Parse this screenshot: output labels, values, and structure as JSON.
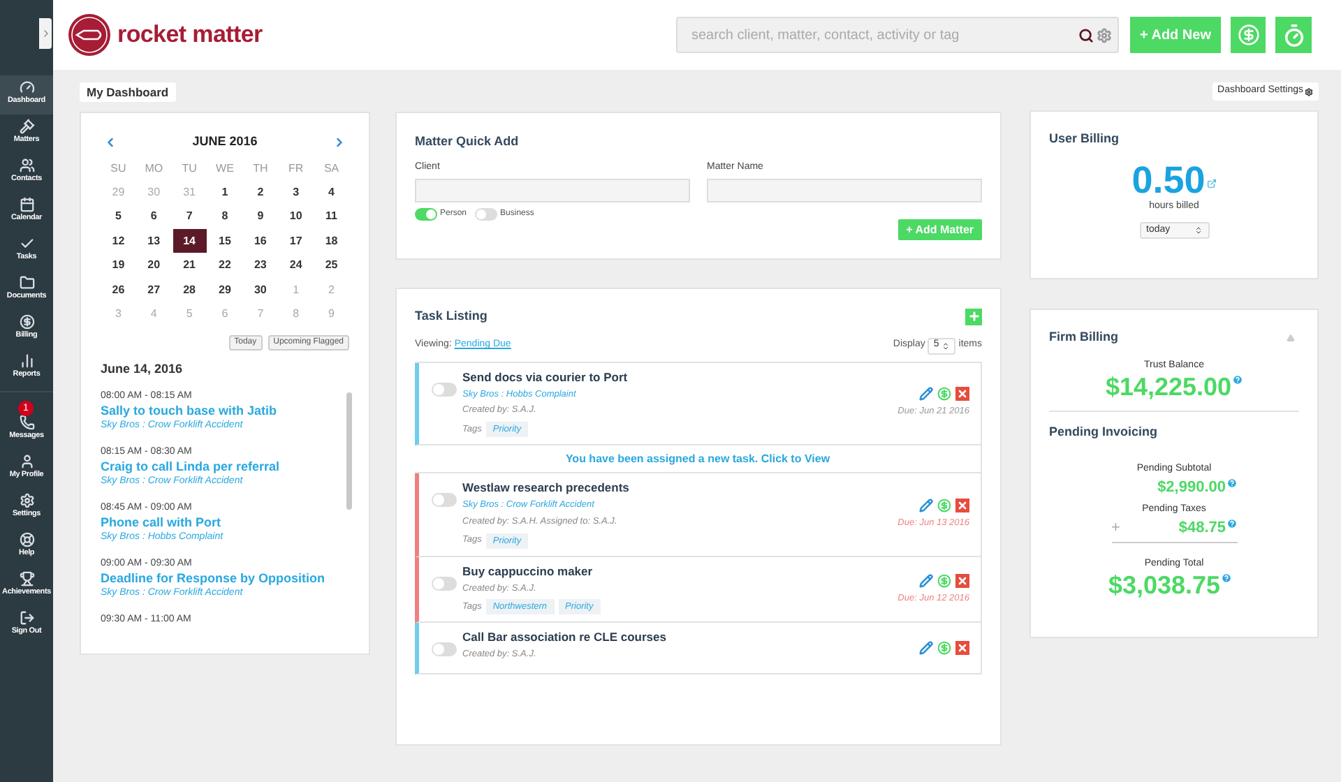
{
  "sidebar": {
    "items": [
      {
        "label": "Dashboard",
        "selected": true
      },
      {
        "label": "Matters",
        "selected": false
      },
      {
        "label": "Contacts",
        "selected": false
      },
      {
        "label": "Calendar",
        "selected": false
      },
      {
        "label": "Tasks",
        "selected": false
      },
      {
        "label": "Documents",
        "selected": false
      },
      {
        "label": "Billing",
        "selected": false
      },
      {
        "label": "Reports",
        "selected": false
      },
      {
        "label": "Messages",
        "selected": false,
        "badge": "1"
      },
      {
        "label": "My Profile",
        "selected": false
      },
      {
        "label": "Settings",
        "selected": false
      },
      {
        "label": "Help",
        "selected": false
      },
      {
        "label": "Achievements",
        "selected": false
      },
      {
        "label": "Sign Out",
        "selected": false
      }
    ]
  },
  "header": {
    "logo": "rocket matter",
    "search": {
      "placeholder": "search client, matter, contact, activity or tag"
    },
    "add_new": "+ Add New"
  },
  "dashboard_tab": "My Dashboard",
  "dashboard_settings": "Dashboard Settings",
  "calendar": {
    "month": "JUNE 2016",
    "weekdays": [
      "SU",
      "MO",
      "TU",
      "WE",
      "TH",
      "FR",
      "SA"
    ],
    "days": [
      {
        "d": "29",
        "outside": true,
        "selected": false
      },
      {
        "d": "30",
        "outside": true,
        "selected": false
      },
      {
        "d": "31",
        "outside": true,
        "selected": false
      },
      {
        "d": "1",
        "outside": false,
        "selected": false
      },
      {
        "d": "2",
        "outside": false,
        "selected": false
      },
      {
        "d": "3",
        "outside": false,
        "selected": false
      },
      {
        "d": "4",
        "outside": false,
        "selected": false
      },
      {
        "d": "5",
        "outside": false,
        "selected": false
      },
      {
        "d": "6",
        "outside": false,
        "selected": false
      },
      {
        "d": "7",
        "outside": false,
        "selected": false
      },
      {
        "d": "8",
        "outside": false,
        "selected": false
      },
      {
        "d": "9",
        "outside": false,
        "selected": false
      },
      {
        "d": "10",
        "outside": false,
        "selected": false
      },
      {
        "d": "11",
        "outside": false,
        "selected": false
      },
      {
        "d": "12",
        "outside": false,
        "selected": false
      },
      {
        "d": "13",
        "outside": false,
        "selected": false
      },
      {
        "d": "14",
        "outside": false,
        "selected": true
      },
      {
        "d": "15",
        "outside": false,
        "selected": false
      },
      {
        "d": "16",
        "outside": false,
        "selected": false
      },
      {
        "d": "17",
        "outside": false,
        "selected": false
      },
      {
        "d": "18",
        "outside": false,
        "selected": false
      },
      {
        "d": "19",
        "outside": false,
        "selected": false
      },
      {
        "d": "20",
        "outside": false,
        "selected": false
      },
      {
        "d": "21",
        "outside": false,
        "selected": false
      },
      {
        "d": "22",
        "outside": false,
        "selected": false
      },
      {
        "d": "23",
        "outside": false,
        "selected": false
      },
      {
        "d": "24",
        "outside": false,
        "selected": false
      },
      {
        "d": "25",
        "outside": false,
        "selected": false
      },
      {
        "d": "26",
        "outside": false,
        "selected": false
      },
      {
        "d": "27",
        "outside": false,
        "selected": false
      },
      {
        "d": "28",
        "outside": false,
        "selected": false
      },
      {
        "d": "29",
        "outside": false,
        "selected": false
      },
      {
        "d": "30",
        "outside": false,
        "selected": false
      },
      {
        "d": "1",
        "outside": true,
        "selected": false
      },
      {
        "d": "2",
        "outside": true,
        "selected": false
      },
      {
        "d": "3",
        "outside": true,
        "selected": false
      },
      {
        "d": "4",
        "outside": true,
        "selected": false
      },
      {
        "d": "5",
        "outside": true,
        "selected": false
      },
      {
        "d": "6",
        "outside": true,
        "selected": false
      },
      {
        "d": "7",
        "outside": true,
        "selected": false
      },
      {
        "d": "8",
        "outside": true,
        "selected": false
      },
      {
        "d": "9",
        "outside": true,
        "selected": false
      }
    ],
    "buttons": [
      "Today",
      "Upcoming Flagged"
    ],
    "date": "June 14, 2016",
    "events": [
      {
        "time": "08:00 AM - 08:15 AM",
        "title": "Sally to touch base with Jatib",
        "matter": "Sky Bros : Crow Forklift Accident"
      },
      {
        "time": "08:15 AM - 08:30 AM",
        "title": "Craig to call Linda per referral",
        "matter": "Sky Bros : Crow Forklift Accident"
      },
      {
        "time": "08:45 AM - 09:00 AM",
        "title": "Phone call with Port",
        "matter": "Sky Bros : Hobbs Complaint"
      },
      {
        "time": "09:00 AM - 09:30 AM",
        "title": "Deadline for Response by Opposition",
        "matter": "Sky Bros : Crow Forklift Accident"
      },
      {
        "time": "09:30 AM - 11:00 AM"
      }
    ]
  },
  "matter_quick_add": {
    "title": "Matter Quick Add",
    "client_label": "Client",
    "matter_label": "Matter Name",
    "toggles": [
      {
        "label": "Person",
        "on": true
      },
      {
        "label": "Business",
        "on": false
      }
    ],
    "button": "+ Add Matter"
  },
  "task_listing": {
    "title": "Task Listing",
    "viewing": "Viewing:",
    "filter": "Pending Due",
    "display": "Display",
    "count": "5",
    "items_label": "items",
    "rows": [
      {
        "kind": "task",
        "title": "Send docs via courier to Port",
        "matter": "Sky Bros : Hobbs Complaint",
        "created": "Created by: S.A.J.",
        "tags_label": "Tags",
        "tags": [
          "Priority"
        ],
        "due": "Due: Jun 21 2016",
        "overdue": false,
        "color": "#6fcdf0",
        "done": false
      },
      {
        "kind": "notice",
        "text": "You have been assigned a new task. Click to View"
      },
      {
        "kind": "task",
        "title": "Westlaw research precedents",
        "matter": "Sky Bros : Crow Forklift Accident",
        "created": "Created by: S.A.H. Assigned to: S.A.J.",
        "tags_label": "Tags",
        "tags": [
          "Priority"
        ],
        "due": "Due: Jun 13 2016",
        "overdue": true,
        "color": "#f08080",
        "done": false
      },
      {
        "kind": "task",
        "title": "Buy cappuccino maker",
        "created": "Created by: S.A.J.",
        "tags_label": "Tags",
        "tags": [
          "Northwestern",
          "Priority"
        ],
        "due": "Due: Jun 12 2016",
        "overdue": true,
        "color": "#f08080",
        "done": false
      },
      {
        "kind": "task",
        "title": "Call Bar association re CLE courses",
        "created": "Created by: S.A.J.",
        "color": "#6fcdf0",
        "done": false
      }
    ]
  },
  "user_billing": {
    "title": "User Billing",
    "hours": "0.50",
    "hours_label": "hours billed",
    "period": "today"
  },
  "firm_billing": {
    "title": "Firm Billing",
    "trust_label": "Trust Balance",
    "trust": "$14,225.00",
    "pending_title": "Pending Invoicing",
    "subtotal_label": "Pending Subtotal",
    "subtotal": "$2,990.00",
    "taxes_label": "Pending Taxes",
    "plus": "+",
    "taxes": "$48.75",
    "total_label": "Pending Total",
    "total": "$3,038.75"
  }
}
